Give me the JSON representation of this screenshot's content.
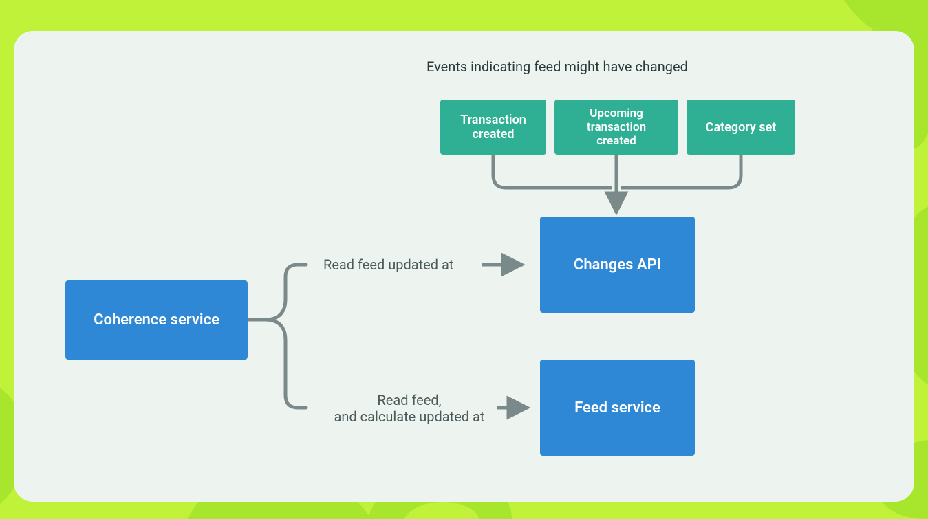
{
  "diagram": {
    "heading": "Events indicating feed might have changed",
    "events": {
      "transaction_created": "Transaction\ncreated",
      "upcoming_transaction_created": "Upcoming transaction\ncreated",
      "category_set": "Category set"
    },
    "services": {
      "coherence": "Coherence service",
      "changes_api": "Changes API",
      "feed_service": "Feed service"
    },
    "edge_labels": {
      "to_changes": "Read feed updated at",
      "to_feed_line1": "Read feed,",
      "to_feed_line2": "and calculate updated at"
    }
  },
  "colors": {
    "bg_lime": "#c0f23a",
    "bg_lime_dark": "#a8e62e",
    "panel": "#edf4f0",
    "blue": "#2e88d6",
    "teal": "#2fb094",
    "stroke": "#7a8a8a",
    "text": "#2a3a3a"
  }
}
